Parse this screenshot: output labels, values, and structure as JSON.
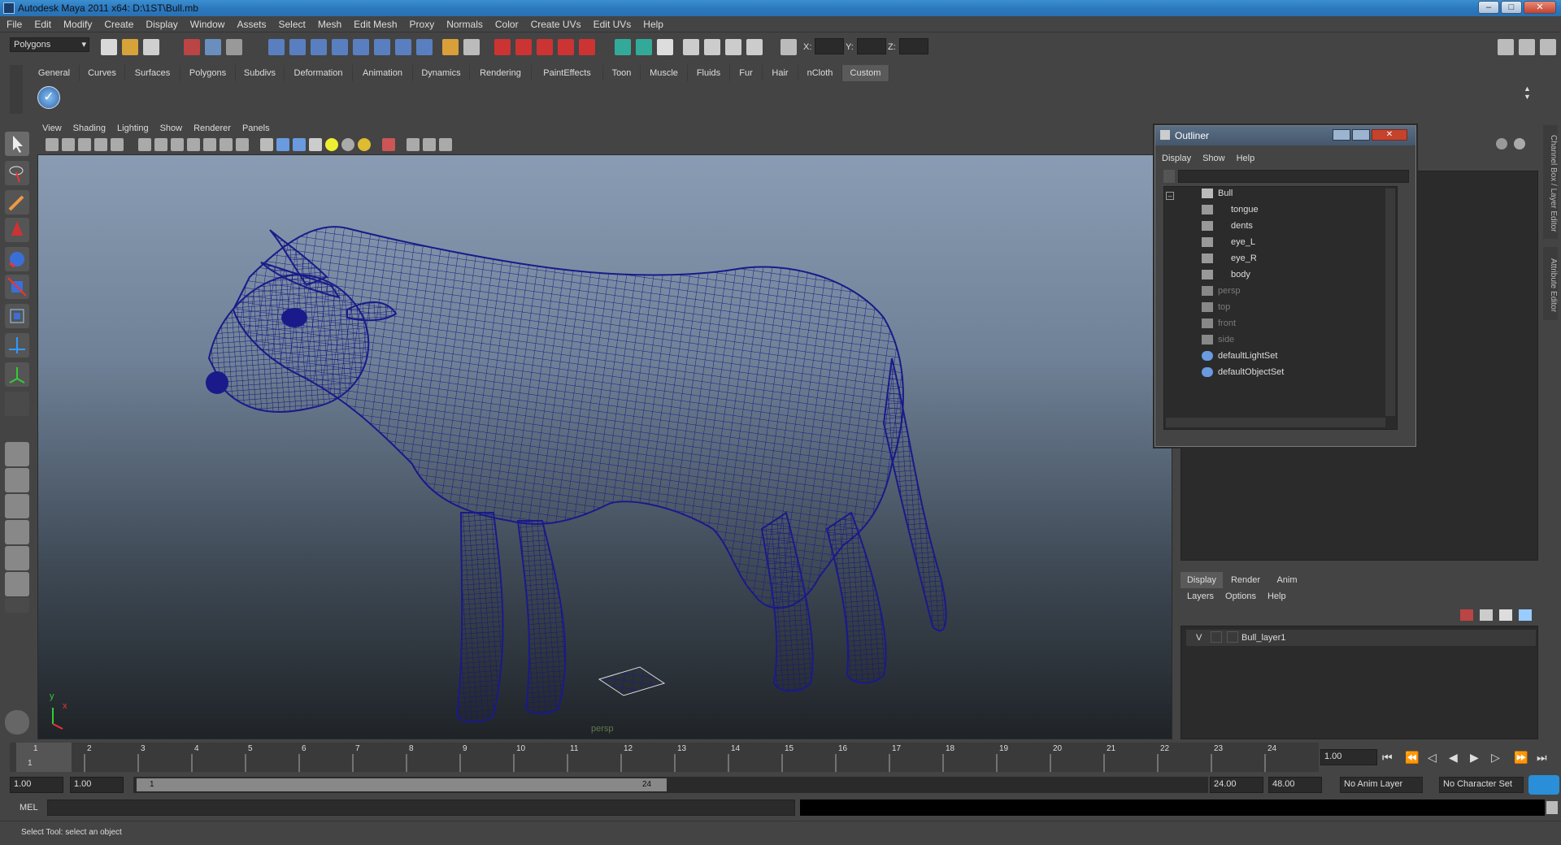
{
  "window": {
    "title": "Autodesk Maya 2011 x64: D:\\1ST\\Bull.mb",
    "min": "–",
    "max": "□",
    "close": "✕"
  },
  "menubar": [
    "File",
    "Edit",
    "Modify",
    "Create",
    "Display",
    "Window",
    "Assets",
    "Select",
    "Mesh",
    "Edit Mesh",
    "Proxy",
    "Normals",
    "Color",
    "Create UVs",
    "Edit UVs",
    "Help"
  ],
  "status": {
    "mode": "Polygons",
    "x_label": "X:",
    "y_label": "Y:",
    "z_label": "Z:"
  },
  "shelf_tabs": [
    "General",
    "Curves",
    "Surfaces",
    "Polygons",
    "Subdivs",
    "Deformation",
    "Animation",
    "Dynamics",
    "Rendering",
    "PaintEffects",
    "Toon",
    "Muscle",
    "Fluids",
    "Fur",
    "Hair",
    "nCloth",
    "Custom"
  ],
  "shelf_active": "Custom",
  "viewport": {
    "menu": [
      "View",
      "Shading",
      "Lighting",
      "Show",
      "Renderer",
      "Panels"
    ],
    "camera": "persp",
    "axis_y": "y",
    "axis_x": "x"
  },
  "outliner": {
    "title": "Outliner",
    "menu": [
      "Display",
      "Show",
      "Help"
    ],
    "items": [
      {
        "name": "Bull",
        "indent": 0,
        "dim": false
      },
      {
        "name": "tongue",
        "indent": 1,
        "dim": false
      },
      {
        "name": "dents",
        "indent": 1,
        "dim": false
      },
      {
        "name": "eye_L",
        "indent": 1,
        "dim": false
      },
      {
        "name": "eye_R",
        "indent": 1,
        "dim": false
      },
      {
        "name": "body",
        "indent": 1,
        "dim": false
      },
      {
        "name": "persp",
        "indent": 0,
        "dim": true
      },
      {
        "name": "top",
        "indent": 0,
        "dim": true
      },
      {
        "name": "front",
        "indent": 0,
        "dim": true
      },
      {
        "name": "side",
        "indent": 0,
        "dim": true
      },
      {
        "name": "defaultLightSet",
        "indent": 0,
        "dim": false
      },
      {
        "name": "defaultObjectSet",
        "indent": 0,
        "dim": false
      }
    ]
  },
  "side_tabs": [
    "Channel Box / Layer Editor",
    "Attribute Editor"
  ],
  "layers": {
    "tabs": [
      "Display",
      "Render",
      "Anim"
    ],
    "active_tab": "Display",
    "menu": [
      "Layers",
      "Options",
      "Help"
    ],
    "rows": [
      {
        "v": "V",
        "name": "Bull_layer1"
      }
    ]
  },
  "timeline": {
    "ticks": [
      "1",
      "2",
      "3",
      "4",
      "5",
      "6",
      "7",
      "8",
      "9",
      "10",
      "11",
      "12",
      "13",
      "14",
      "15",
      "16",
      "17",
      "18",
      "19",
      "20",
      "21",
      "22",
      "23",
      "24"
    ],
    "current_frame": "1",
    "current_field": "1.00"
  },
  "range": {
    "start": "1.00",
    "start2": "1.00",
    "slider_start": "1",
    "slider_end": "24",
    "end": "24.00",
    "end2": "48.00",
    "anim_layer": "No Anim Layer",
    "char_set": "No Character Set"
  },
  "cmd": {
    "label": "MEL"
  },
  "help": {
    "text": "Select Tool: select an object"
  },
  "colors": {
    "wire": "#1a1a8a",
    "accent": "#5a6f86"
  }
}
